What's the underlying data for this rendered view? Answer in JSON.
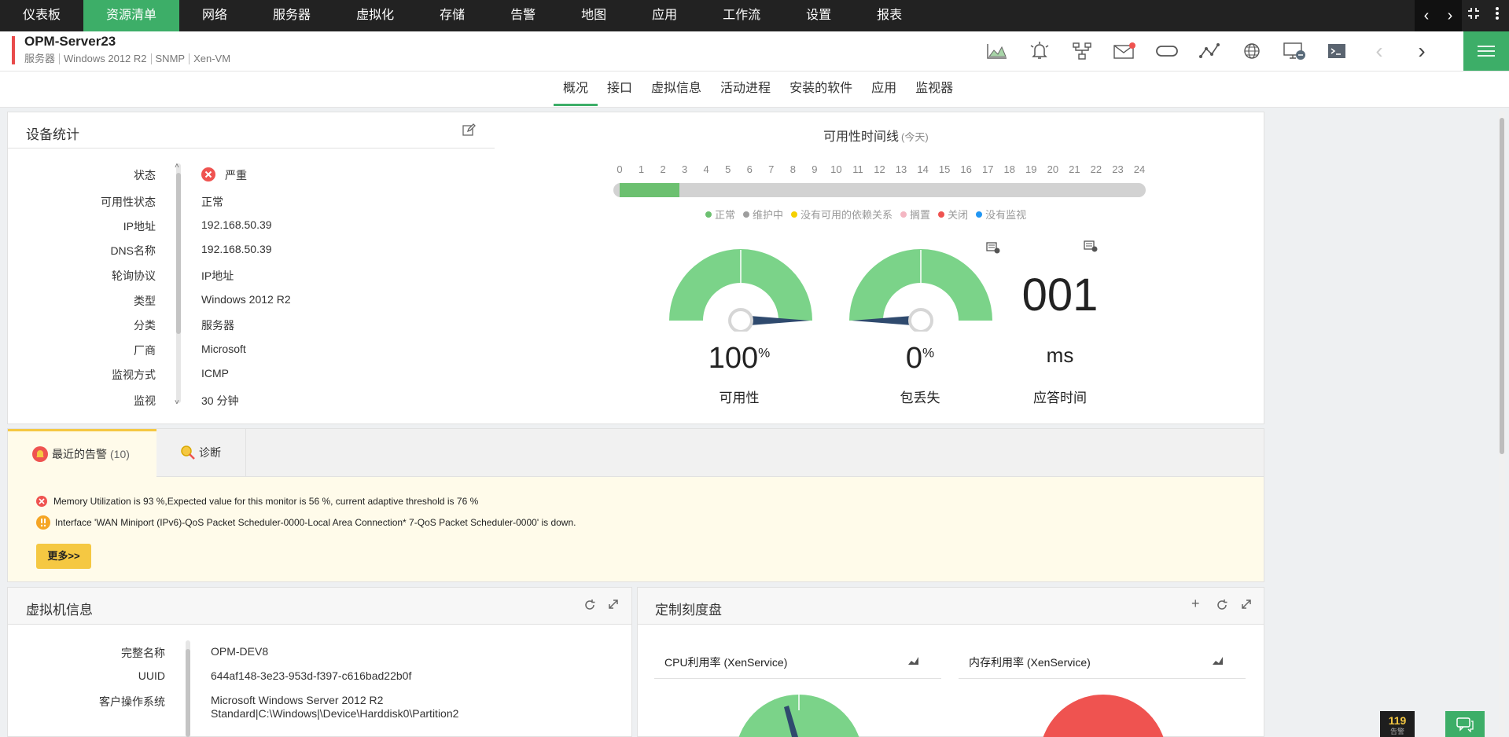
{
  "nav": {
    "items": [
      "仪表板",
      "资源清单",
      "网络",
      "服务器",
      "虚拟化",
      "存储",
      "告警",
      "地图",
      "应用",
      "工作流",
      "设置",
      "报表"
    ],
    "active_index": 1
  },
  "device": {
    "name": "OPM-Server23",
    "meta": [
      "服务器",
      "Windows 2012 R2",
      "SNMP",
      "Xen-VM"
    ]
  },
  "subtabs": {
    "items": [
      "概况",
      "接口",
      "虚拟信息",
      "活动进程",
      "安装的软件",
      "应用",
      "监视器"
    ],
    "active_index": 0
  },
  "device_stats": {
    "title": "设备统计",
    "rows": [
      {
        "label": "状态",
        "value": "严重",
        "status": "critical"
      },
      {
        "label": "可用性状态",
        "value": "正常"
      },
      {
        "label": "IP地址",
        "value": "192.168.50.39"
      },
      {
        "label": "DNS名称",
        "value": "192.168.50.39"
      },
      {
        "label": "轮询协议",
        "value": "IP地址"
      },
      {
        "label": "类型",
        "value": "Windows 2012 R2"
      },
      {
        "label": "分类",
        "value": "服务器"
      },
      {
        "label": "厂商",
        "value": "Microsoft"
      },
      {
        "label": "监视方式",
        "value": "ICMP"
      },
      {
        "label": "监视",
        "value": "30 分钟"
      }
    ]
  },
  "availability_timeline": {
    "title": "可用性时间线",
    "subtitle": "(今天)",
    "hours": [
      "0",
      "1",
      "2",
      "3",
      "4",
      "5",
      "6",
      "7",
      "8",
      "9",
      "10",
      "11",
      "12",
      "13",
      "14",
      "15",
      "16",
      "17",
      "18",
      "19",
      "20",
      "21",
      "22",
      "23",
      "24"
    ],
    "up_until_hour": 2.75,
    "legend": [
      {
        "label": "正常",
        "color": "#6cc070"
      },
      {
        "label": "维护中",
        "color": "#9e9e9e"
      },
      {
        "label": "没有可用的依赖关系",
        "color": "#f5d000"
      },
      {
        "label": "搁置",
        "color": "#f4b6c2"
      },
      {
        "label": "关闭",
        "color": "#ef5350"
      },
      {
        "label": "没有监视",
        "color": "#2196f3"
      }
    ]
  },
  "gauges": {
    "availability": {
      "value": "100",
      "unit": "%",
      "label": "可用性",
      "fraction": 1.0
    },
    "packet_loss": {
      "value": "0",
      "unit": "%",
      "label": "包丢失",
      "fraction": 0.0
    },
    "response_time": {
      "value": "001",
      "unit": "ms",
      "label": "应答时间"
    }
  },
  "alerts": {
    "tab_recent": "最近的告警",
    "tab_recent_count": "(10)",
    "tab_diag": "诊断",
    "items": [
      {
        "severity": "critical",
        "text": "Memory Utilization is 93 %,Expected value for this monitor is 56 %, current adaptive threshold is 76 %"
      },
      {
        "severity": "warning",
        "text": "Interface 'WAN Miniport (IPv6)-QoS Packet Scheduler-0000-Local Area Connection* 7-QoS Packet Scheduler-0000' is down."
      }
    ],
    "more_label": "更多>>"
  },
  "vm_info": {
    "title": "虚拟机信息",
    "rows": [
      {
        "label": "完整名称",
        "value": "OPM-DEV8"
      },
      {
        "label": "UUID",
        "value": "644af148-3e23-953d-f397-c616bad22b0f"
      },
      {
        "label": "客户操作系统",
        "value": "Microsoft Windows Server 2012 R2",
        "value2": "Standard|C:\\Windows|\\Device\\Harddisk0\\Partition2"
      }
    ]
  },
  "custom_dials": {
    "title": "定制刻度盘",
    "cpu_title": "CPU利用率 (XenService)",
    "mem_title": "内存利用率 (XenService)"
  },
  "footer": {
    "alarm_count": "119",
    "alarm_label": "告警"
  },
  "colors": {
    "accent_green": "#3dae68",
    "gauge_green": "#7bd389",
    "critical_red": "#ef5350",
    "needle": "#2f4a6e"
  }
}
